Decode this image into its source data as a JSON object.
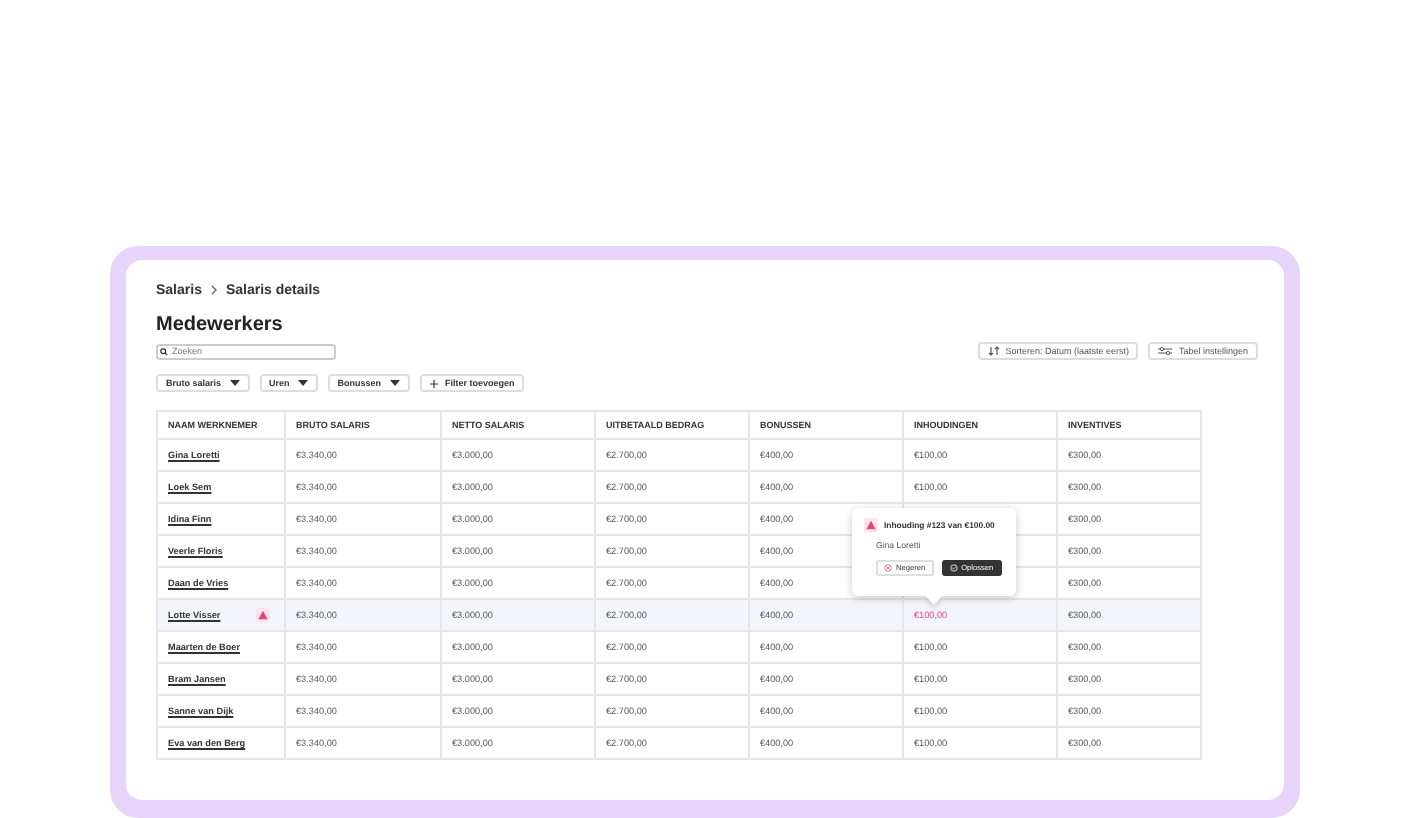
{
  "breadcrumb": [
    {
      "label": "Salaris"
    },
    {
      "label": "Salaris details"
    }
  ],
  "title": "Medewerkers",
  "search": {
    "placeholder": "Zoeken"
  },
  "filters": [
    {
      "label": "Bruto salaris"
    },
    {
      "label": "Uren"
    },
    {
      "label": "Bonussen"
    }
  ],
  "add_filter": "Filter toevoegen",
  "sort_button": "Sorteren: Datum (laatste eerst)",
  "settings_button": "Tabel instellingen",
  "table": {
    "columns": [
      "NAAM WERKNEMER",
      "BRUTO SALARIS",
      "NETTO SALARIS",
      "UITBETAALD BEDRAG",
      "BONUSSEN",
      "INHOUDINGEN",
      "INVENTIVES"
    ],
    "rows": [
      {
        "cells": [
          "Gina Loretti",
          "€3.340,00",
          "€3.000,00",
          "€2.700,00",
          "€400,00",
          "€100,00",
          "€300,00"
        ],
        "selected": false,
        "flagged": false
      },
      {
        "cells": [
          "Loek Sem",
          "€3.340,00",
          "€3.000,00",
          "€2.700,00",
          "€400,00",
          "€100,00",
          "€300,00"
        ],
        "selected": false,
        "flagged": false
      },
      {
        "cells": [
          "Idina Finn",
          "€3.340,00",
          "€3.000,00",
          "€2.700,00",
          "€400,00",
          "",
          "€300,00"
        ],
        "selected": false,
        "flagged": false
      },
      {
        "cells": [
          "Veerle Floris",
          "€3.340,00",
          "€3.000,00",
          "€2.700,00",
          "€400,00",
          "",
          "€300,00"
        ],
        "selected": false,
        "flagged": false
      },
      {
        "cells": [
          "Daan de Vries",
          "€3.340,00",
          "€3.000,00",
          "€2.700,00",
          "€400,00",
          "",
          "€300,00"
        ],
        "selected": false,
        "flagged": false
      },
      {
        "cells": [
          "Lotte Visser",
          "€3.340,00",
          "€3.000,00",
          "€2.700,00",
          "€400,00",
          "€100,00",
          "€300,00"
        ],
        "selected": true,
        "flagged": true
      },
      {
        "cells": [
          "Maarten de Boer",
          "€3.340,00",
          "€3.000,00",
          "€2.700,00",
          "€400,00",
          "€100,00",
          "€300,00"
        ],
        "selected": false,
        "flagged": false
      },
      {
        "cells": [
          "Bram Jansen",
          "€3.340,00",
          "€3.000,00",
          "€2.700,00",
          "€400,00",
          "€100,00",
          "€300,00"
        ],
        "selected": false,
        "flagged": false
      },
      {
        "cells": [
          "Sanne van Dijk",
          "€3.340,00",
          "€3.000,00",
          "€2.700,00",
          "€400,00",
          "€100,00",
          "€300,00"
        ],
        "selected": false,
        "flagged": false
      },
      {
        "cells": [
          "Eva van den Berg",
          "€3.340,00",
          "€3.000,00",
          "€2.700,00",
          "€400,00",
          "€100,00",
          "€300,00"
        ],
        "selected": false,
        "flagged": false
      }
    ]
  },
  "popover": {
    "title": "Inhouding #123 van €100.00",
    "subtitle": "Gina Loretti",
    "buttons": [
      {
        "label": "Negeren",
        "kind": "secondary"
      },
      {
        "label": "Oplossen",
        "kind": "primary"
      }
    ]
  }
}
